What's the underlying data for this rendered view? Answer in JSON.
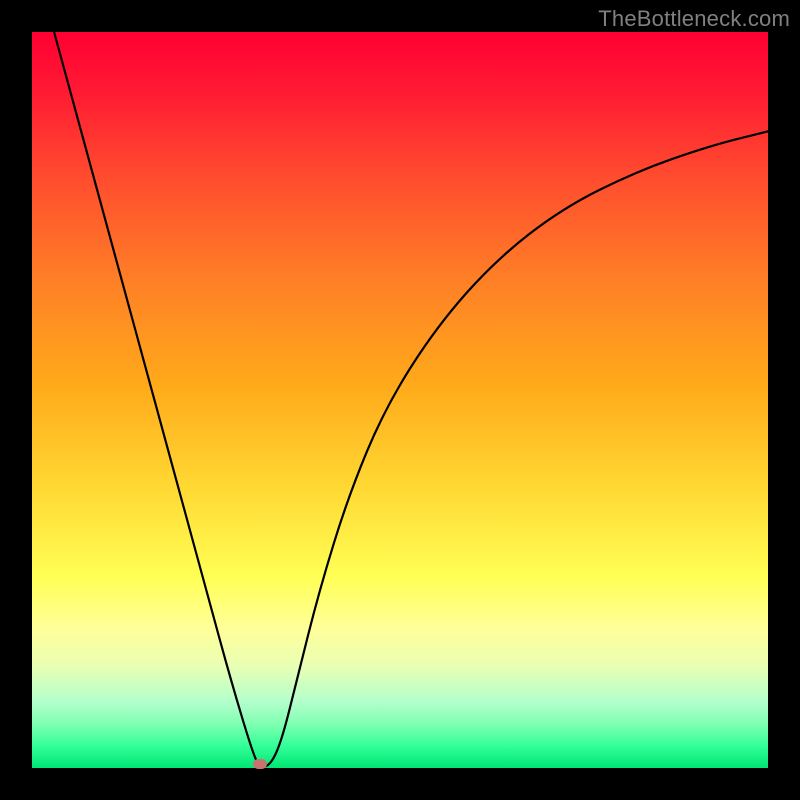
{
  "watermark": "TheBottleneck.com",
  "chart_data": {
    "type": "line",
    "title": "",
    "xlabel": "",
    "ylabel": "",
    "xlim": [
      0,
      100
    ],
    "ylim": [
      0,
      100
    ],
    "grid": false,
    "series": [
      {
        "name": "curve",
        "x": [
          3,
          6,
          9,
          12,
          15,
          18,
          21,
          24,
          27,
          30,
          31,
          32.5,
          34,
          36,
          39,
          43,
          48,
          55,
          63,
          72,
          82,
          92,
          100
        ],
        "y": [
          100,
          89,
          78,
          67,
          56,
          45,
          34,
          23,
          12,
          2,
          0,
          0.5,
          4,
          12,
          24,
          37,
          49,
          60,
          69,
          76,
          81,
          84.5,
          86.5
        ]
      }
    ],
    "marker": {
      "x": 31,
      "y": 0.5
    },
    "background_gradient": {
      "top": "#ff0033",
      "mid1": "#ffaa1a",
      "mid2": "#ffff55",
      "bottom": "#00e673"
    }
  }
}
